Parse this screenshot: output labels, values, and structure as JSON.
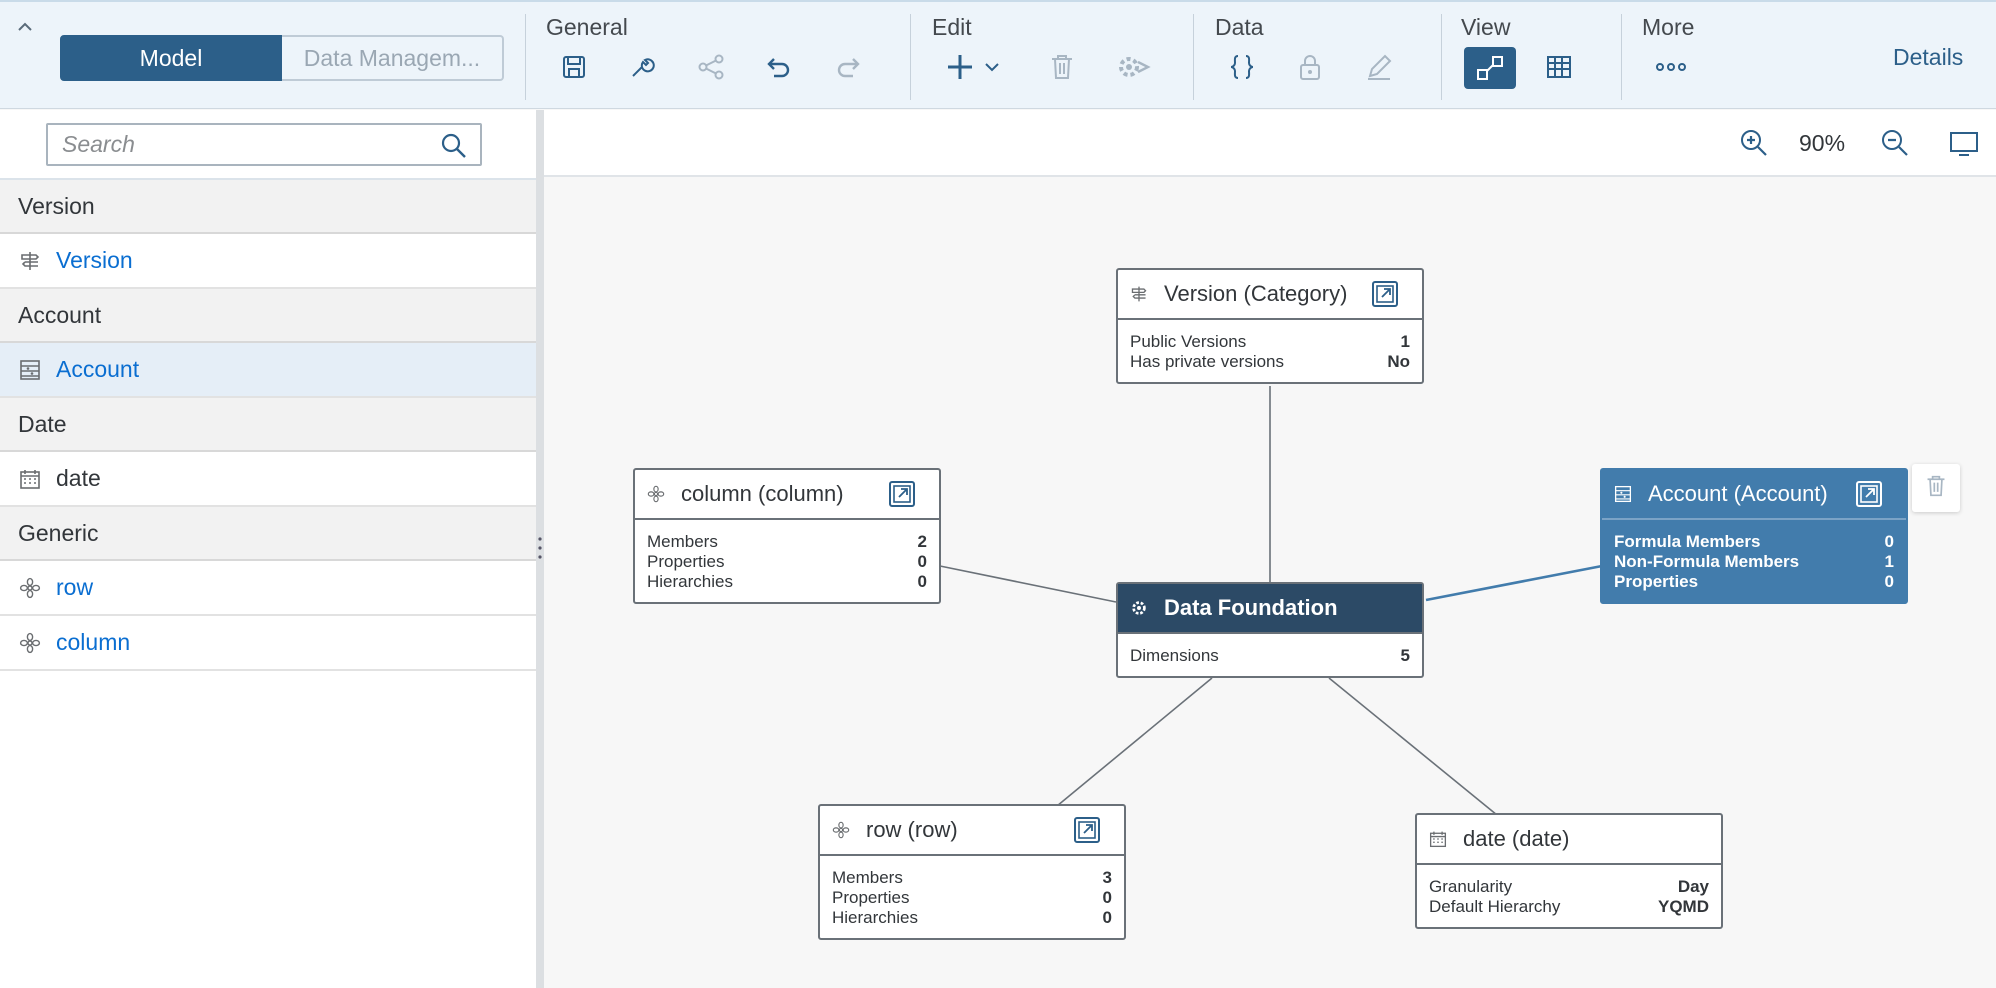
{
  "toolbar": {
    "mode_tabs": [
      "Model",
      "Data Managem..."
    ],
    "groups": {
      "general": "General",
      "edit": "Edit",
      "data": "Data",
      "view": "View",
      "more": "More"
    },
    "details_label": "Details"
  },
  "sidebar": {
    "search_placeholder": "Search",
    "sections": [
      {
        "header": "Version",
        "items": [
          {
            "label": "Version",
            "icon": "version-icon"
          }
        ]
      },
      {
        "header": "Account",
        "items": [
          {
            "label": "Account",
            "icon": "account-icon",
            "active": true
          }
        ]
      },
      {
        "header": "Date",
        "items": [
          {
            "label": "date",
            "icon": "calendar-icon"
          }
        ]
      },
      {
        "header": "Generic",
        "items": [
          {
            "label": "row",
            "icon": "generic-icon"
          },
          {
            "label": "column",
            "icon": "generic-icon"
          }
        ]
      }
    ]
  },
  "canvas": {
    "zoom_level": "90%",
    "nodes": {
      "version": {
        "title": "Version (Category)",
        "rows": [
          {
            "k": "Public Versions",
            "v": "1"
          },
          {
            "k": "Has private versions",
            "v": "No"
          }
        ]
      },
      "column": {
        "title": "column (column)",
        "rows": [
          {
            "k": "Members",
            "v": "2"
          },
          {
            "k": "Properties",
            "v": "0"
          },
          {
            "k": "Hierarchies",
            "v": "0"
          }
        ]
      },
      "account": {
        "title": "Account (Account)",
        "rows": [
          {
            "k": "Formula Members",
            "v": "0"
          },
          {
            "k": "Non-Formula Members",
            "v": "1"
          },
          {
            "k": "Properties",
            "v": "0"
          }
        ]
      },
      "foundation": {
        "title": "Data Foundation",
        "rows": [
          {
            "k": "Dimensions",
            "v": "5"
          }
        ]
      },
      "row": {
        "title": "row (row)",
        "rows": [
          {
            "k": "Members",
            "v": "3"
          },
          {
            "k": "Properties",
            "v": "0"
          },
          {
            "k": "Hierarchies",
            "v": "0"
          }
        ]
      },
      "date": {
        "title": "date (date)",
        "rows": [
          {
            "k": "Granularity",
            "v": "Day"
          },
          {
            "k": "Default Hierarchy",
            "v": "YQMD"
          }
        ]
      }
    }
  },
  "colors": {
    "brand": "#2c5f89",
    "selected_node": "#427cac",
    "foundation_header": "#2c4a66",
    "link": "#0a6ed1"
  }
}
